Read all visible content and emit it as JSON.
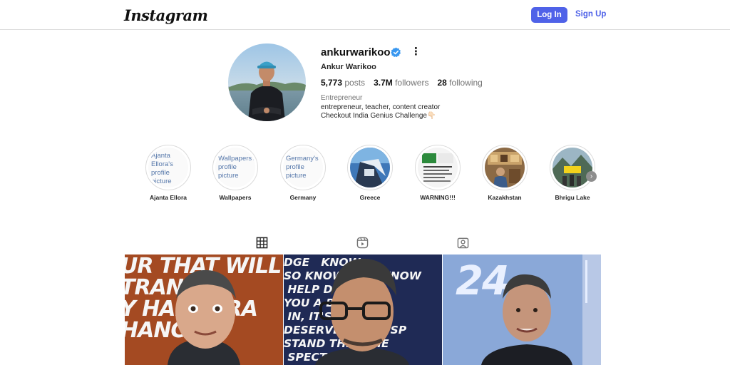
{
  "header": {
    "logo": "Instagram",
    "login_label": "Log In",
    "signup_label": "Sign Up"
  },
  "profile": {
    "username": "ankurwarikoo",
    "full_name": "Ankur Warikoo",
    "posts_count": "5,773",
    "posts_label": "posts",
    "followers_count": "3.7M",
    "followers_label": "followers",
    "following_count": "28",
    "following_label": "following",
    "category": "Entrepreneur",
    "bio_line1": "entrepreneur, teacher, content creator",
    "bio_line2": "Checkout India Genius Challenge👇🏻"
  },
  "highlights": [
    {
      "label": "Ajanta Ellora",
      "alt_text": "Ajanta Ellora's profile picture"
    },
    {
      "label": "Wallpapers",
      "alt_text": "Wallpapers's profile picture"
    },
    {
      "label": "Germany",
      "alt_text": "Germany's profile picture"
    },
    {
      "label": "Greece"
    },
    {
      "label": "WARNING!!!"
    },
    {
      "label": "Kazakhstan"
    },
    {
      "label": "Bhrigu Lake"
    }
  ],
  "tabs": [
    {
      "icon": "grid-icon"
    },
    {
      "icon": "reels-icon"
    },
    {
      "icon": "tagged-icon"
    }
  ],
  "posts": [
    {
      "overlay": "UR THAT WILL\nTRAN   IS\nY HAD     RA\nHANCE\n"
    },
    {
      "overlay": "DGE   KNOW\nSO KNOW  YOU KNOW\n HELP D  YOU AS\nYOU A B   NOT BE\n IN, IT'S   ND TH\nDESERVE   YOUR SP\nSTAND THE  FRIE\n SPECT      ESI"
    },
    {
      "overlay": "24"
    }
  ],
  "colors": {
    "accent": "#4f62e8",
    "verified": "#3897f0",
    "border": "#dbdbdb"
  }
}
